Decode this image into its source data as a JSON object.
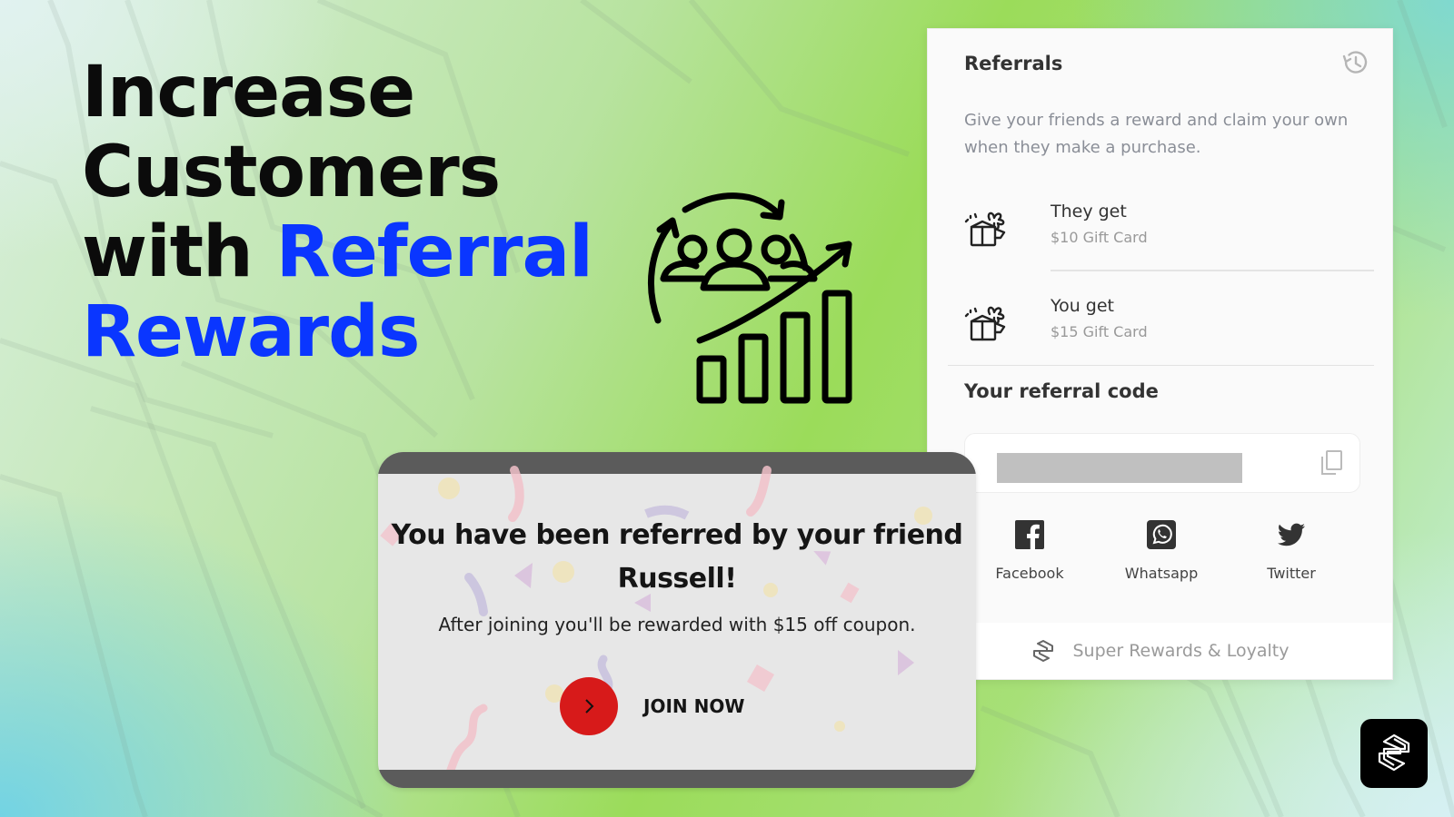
{
  "headline": {
    "line1": "Increase",
    "line2": "Customers",
    "line3_plain": "with ",
    "line3_accent": "Referral",
    "line4_accent": "Rewards",
    "accent_color": "#0a36ff"
  },
  "illustration": {
    "icon": "customer-growth-icon"
  },
  "referrals_panel": {
    "title": "Referrals",
    "history_icon": "history-icon",
    "description": "Give your friends a reward and claim your own when they make a purchase.",
    "rewards": [
      {
        "label": "They get",
        "value": "$10 Gift Card",
        "icon": "gift-icon"
      },
      {
        "label": "You get",
        "value": "$15 Gift Card",
        "icon": "gift-icon"
      }
    ],
    "code_section_title": "Your referral code",
    "code_value": "",
    "copy_icon": "copy-icon",
    "share_options": [
      {
        "label": "Facebook",
        "icon": "facebook-icon"
      },
      {
        "label": "Whatsapp",
        "icon": "whatsapp-icon"
      },
      {
        "label": "Twitter",
        "icon": "twitter-icon"
      }
    ],
    "footer_text": "Super Rewards & Loyalty"
  },
  "referred_card": {
    "heading_line1": "You have been referred by your friend",
    "heading_line2": "Russell!",
    "subtext": "After joining you'll be rewarded with $15 off coupon.",
    "cta_label": "JOIN NOW",
    "cta_color": "#d71a1a"
  },
  "brand_badge": {
    "icon": "super-rewards-logo-icon"
  }
}
